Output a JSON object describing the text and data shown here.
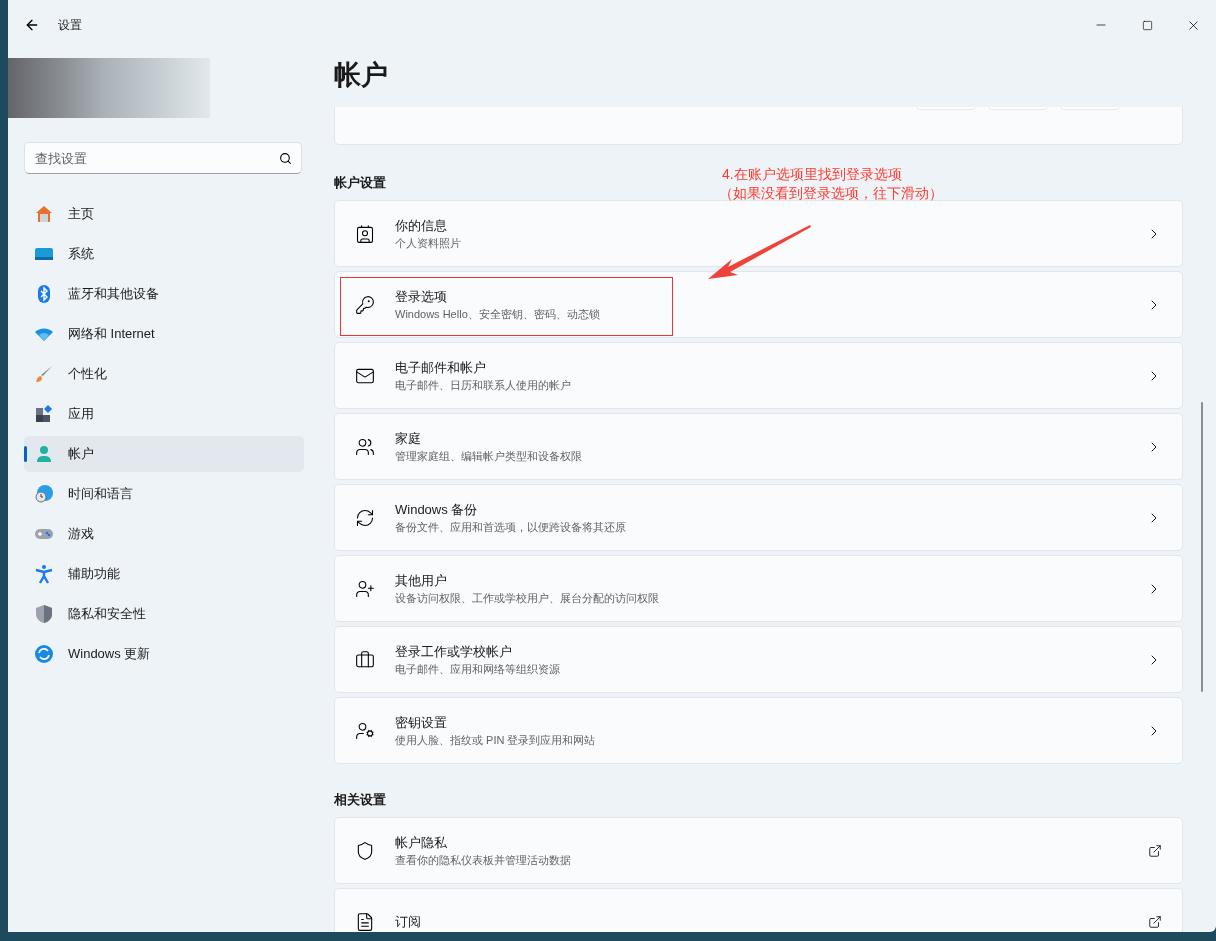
{
  "window": {
    "title": "设置"
  },
  "search": {
    "placeholder": "查找设置"
  },
  "sidebar": {
    "items": [
      {
        "label": "主页",
        "selected": false
      },
      {
        "label": "系统",
        "selected": false
      },
      {
        "label": "蓝牙和其他设备",
        "selected": false
      },
      {
        "label": "网络和 Internet",
        "selected": false
      },
      {
        "label": "个性化",
        "selected": false
      },
      {
        "label": "应用",
        "selected": false
      },
      {
        "label": "帐户",
        "selected": true
      },
      {
        "label": "时间和语言",
        "selected": false
      },
      {
        "label": "游戏",
        "selected": false
      },
      {
        "label": "辅助功能",
        "selected": false
      },
      {
        "label": "隐私和安全性",
        "selected": false
      },
      {
        "label": "Windows 更新",
        "selected": false
      }
    ]
  },
  "page_title": "帐户",
  "sections": [
    {
      "heading": "帐户设置",
      "items": [
        {
          "title": "你的信息",
          "subtitle": "个人资料照片",
          "kind": "nav"
        },
        {
          "title": "登录选项",
          "subtitle": "Windows Hello、安全密钥、密码、动态锁",
          "kind": "nav"
        },
        {
          "title": "电子邮件和帐户",
          "subtitle": "电子邮件、日历和联系人使用的帐户",
          "kind": "nav"
        },
        {
          "title": "家庭",
          "subtitle": "管理家庭组、编辑帐户类型和设备权限",
          "kind": "nav"
        },
        {
          "title": "Windows 备份",
          "subtitle": "备份文件、应用和首选项，以便跨设备将其还原",
          "kind": "nav"
        },
        {
          "title": "其他用户",
          "subtitle": "设备访问权限、工作或学校用户、展台分配的访问权限",
          "kind": "nav"
        },
        {
          "title": "登录工作或学校帐户",
          "subtitle": "电子邮件、应用和网络等组织资源",
          "kind": "nav"
        },
        {
          "title": "密钥设置",
          "subtitle": "使用人脸、指纹或 PIN 登录到应用和网站",
          "kind": "nav"
        }
      ]
    },
    {
      "heading": "相关设置",
      "items": [
        {
          "title": "帐户隐私",
          "subtitle": "查看你的隐私仪表板并管理活动数据",
          "kind": "external"
        },
        {
          "title": "订阅",
          "kind": "external"
        }
      ]
    }
  ],
  "annotation": {
    "lines": [
      "4.在账户选项里找到登录选项",
      "（如果没看到登录选项，往下滑动）"
    ]
  }
}
